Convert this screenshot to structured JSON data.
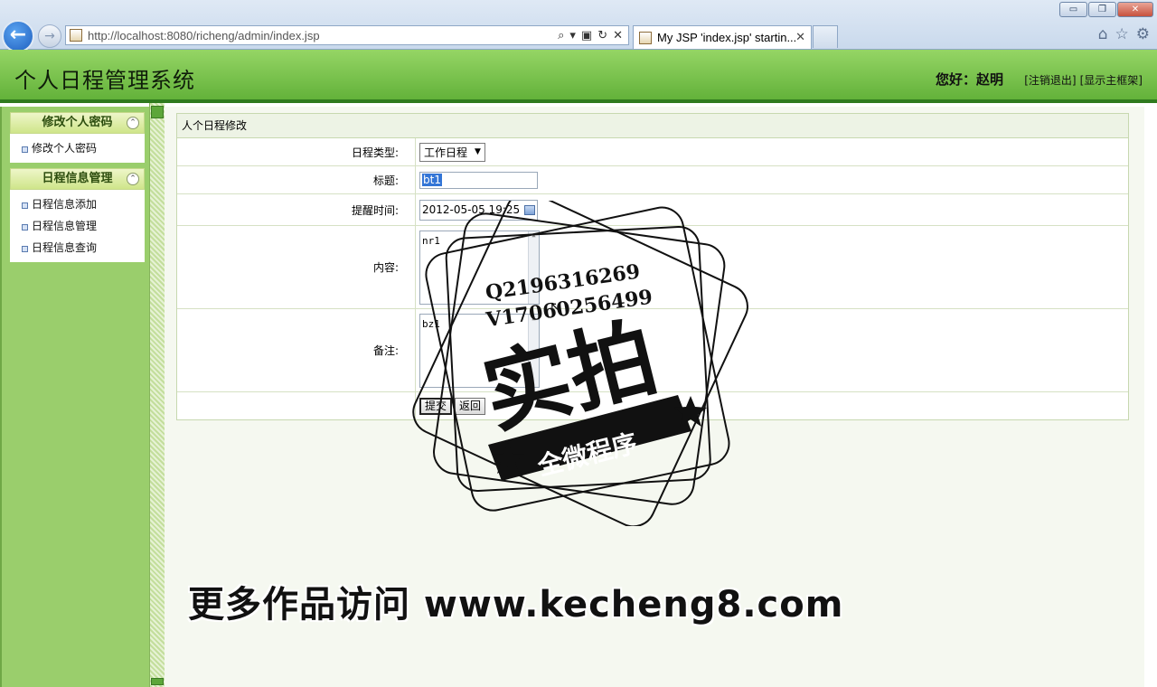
{
  "browser": {
    "window_buttons": [
      "▭",
      "❐",
      "✕"
    ],
    "back_glyph": "←",
    "forward_glyph": "→",
    "url": "http://localhost:8080/richeng/admin/index.jsp",
    "tab_title": "My JSP 'index.jsp' startin...",
    "tab_close": "✕",
    "tool_glyphs": [
      "⌂",
      "☆",
      "⚙"
    ],
    "address_glyphs": [
      "⌕",
      "▾",
      "▣",
      "↻",
      "✕"
    ]
  },
  "header": {
    "title": "个人日程管理系统",
    "greeting": "您好：赵明",
    "logout_link": "[注销退出]",
    "frame_link": "[显示主框架]"
  },
  "sidebar": {
    "groups": [
      {
        "title": "修改个人密码",
        "items": [
          "修改个人密码"
        ]
      },
      {
        "title": "日程信息管理",
        "items": [
          "日程信息添加",
          "日程信息管理",
          "日程信息查询"
        ]
      }
    ],
    "collapse_glyph": "⌃"
  },
  "form": {
    "panel_title": "人个日程修改",
    "type_label": "日程类型:",
    "type_value": "工作日程",
    "title_label": "标题:",
    "title_value": "bt1",
    "remind_label": "提醒时间:",
    "remind_value": "2012-05-05 19:25",
    "content_label": "内容:",
    "content_value": "nr1",
    "remark_label": "备注:",
    "remark_value": "bz1",
    "submit_label": "提交",
    "back_label": "返回",
    "select_arrow": "▼",
    "scroll_arrow": "▲"
  },
  "watermark": {
    "line1": "Q2196316269",
    "line2": "V17060256499",
    "big_text": "实拍",
    "banner_text": "全微程序",
    "website": "更多作品访问 www.kecheng8.com"
  }
}
